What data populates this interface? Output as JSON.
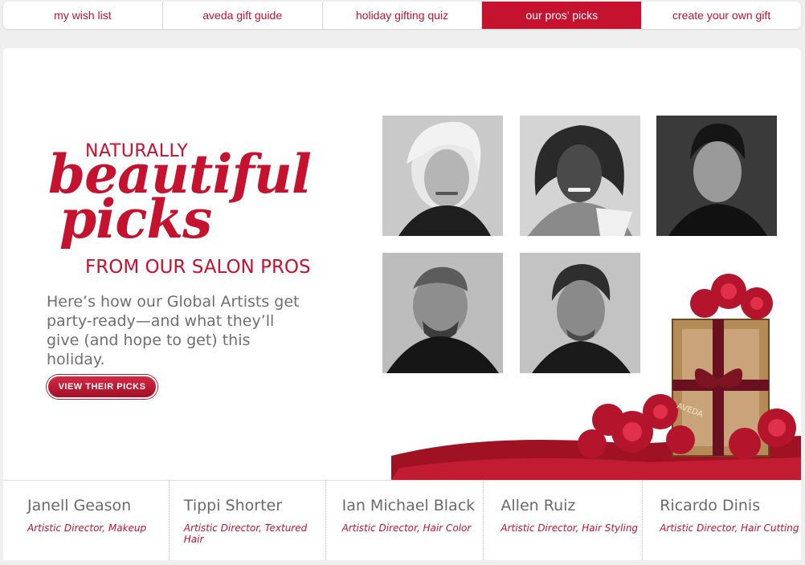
{
  "nav": {
    "tabs": [
      {
        "label": "my wish list",
        "active": false
      },
      {
        "label": "aveda gift guide",
        "active": false
      },
      {
        "label": "holiday gifting quiz",
        "active": false
      },
      {
        "label": "our pros’ picks",
        "active": true
      },
      {
        "label": "create your own gift",
        "active": false
      }
    ]
  },
  "hero": {
    "headline_top": "NATURALLY",
    "headline_script_1": "beautiful",
    "headline_script_2": "picks",
    "headline_bottom": "FROM OUR SALON PROS",
    "intro": "Here’s how our Global Artists get party-ready—and what they’ll give (and hope to get) this holiday.",
    "cta_label": "VIEW THEIR PICKS"
  },
  "gift_ribbon_text": "AVEDA",
  "pros": [
    {
      "name": "Janell Geason",
      "title": "Artistic Director, Makeup"
    },
    {
      "name": "Tippi Shorter",
      "title": "Artistic Director, Textured Hair"
    },
    {
      "name": "Ian Michael Black",
      "title": "Artistic Director, Hair Color"
    },
    {
      "name": "Allen Ruiz",
      "title": "Artistic Director, Hair Styling"
    },
    {
      "name": "Ricardo Dinis",
      "title": "Artistic Director, Hair Cutting"
    }
  ],
  "colors": {
    "brand_red": "#c4122f",
    "text_gray": "#6f6f6f"
  }
}
